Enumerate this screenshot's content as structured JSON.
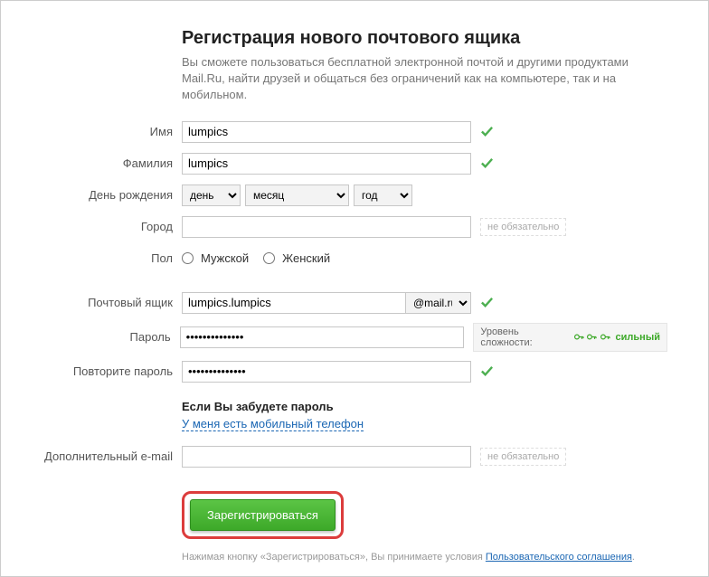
{
  "header": {
    "title": "Регистрация нового почтового ящика",
    "subtitle": "Вы сможете пользоваться бесплатной электронной почтой и другими продуктами Mail.Ru, найти друзей и общаться без ограничений как на компьютере, так и на мобильном."
  },
  "labels": {
    "firstname": "Имя",
    "lastname": "Фамилия",
    "birthday": "День рождения",
    "city": "Город",
    "gender": "Пол",
    "mailbox": "Почтовый ящик",
    "password": "Пароль",
    "password_repeat": "Повторите пароль",
    "extra_email": "Дополнительный e-mail"
  },
  "values": {
    "firstname": "lumpics",
    "lastname": "lumpics",
    "mailbox": "lumpics.lumpics",
    "password": "••••••••••••••",
    "password_repeat": "••••••••••••••"
  },
  "selects": {
    "day": "день",
    "month": "месяц",
    "year": "год",
    "domain": "@mail.ru"
  },
  "gender": {
    "male": "Мужской",
    "female": "Женский"
  },
  "hints": {
    "optional": "не обязательно"
  },
  "strength": {
    "label": "Уровень сложности:",
    "level": "сильный"
  },
  "forgot": {
    "title": "Если Вы забудете пароль",
    "link": "У меня есть мобильный телефон"
  },
  "submit": {
    "label": "Зарегистрироваться"
  },
  "agreement": {
    "prefix": "Нажимая кнопку «Зарегистрироваться», Вы принимаете условия ",
    "link": "Пользовательского соглашения",
    "suffix": "."
  }
}
